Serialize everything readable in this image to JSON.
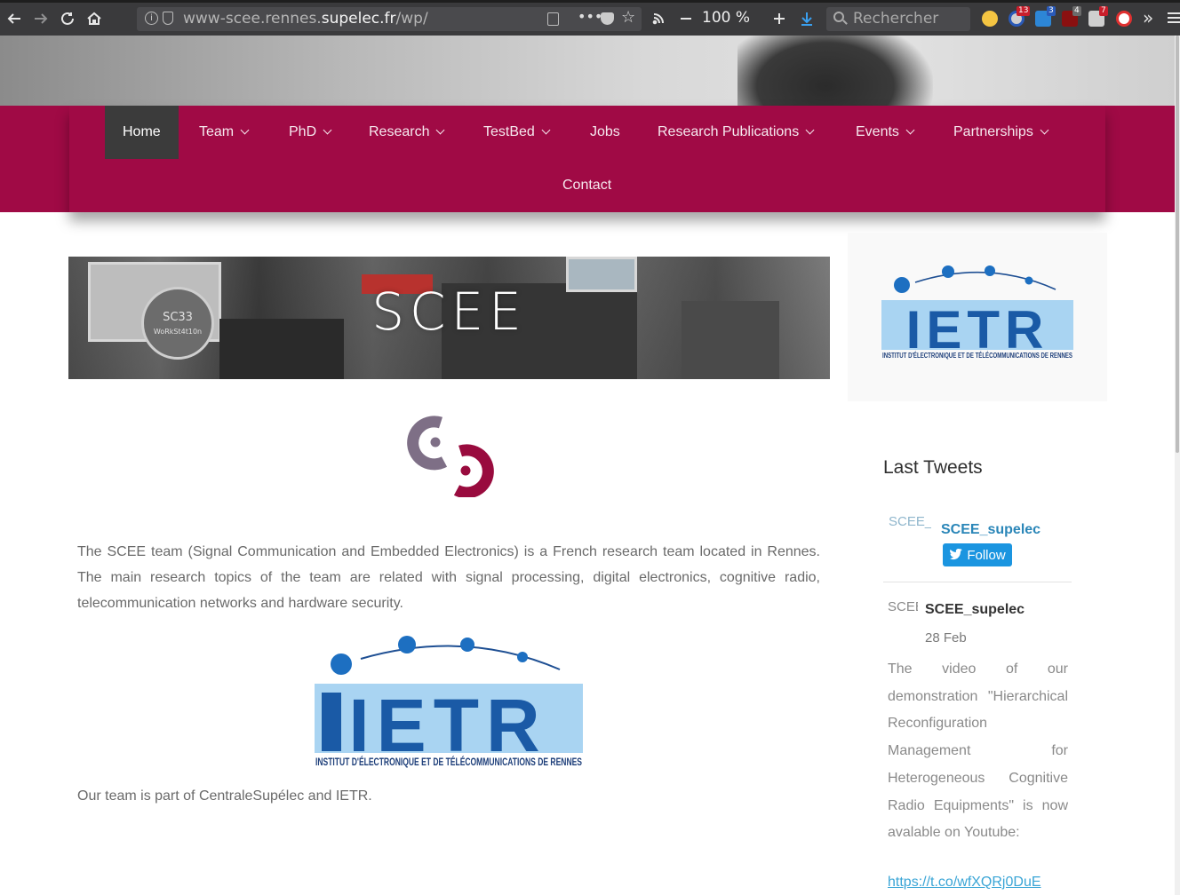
{
  "browser": {
    "url_prefix": "www-scee.rennes.",
    "url_domain": "supelec.fr",
    "url_path": "/wp/",
    "zoom": "100 %",
    "search_placeholder": "Rechercher",
    "badges": [
      "13",
      "3",
      "4",
      "7"
    ]
  },
  "nav": {
    "items": [
      {
        "label": "Home",
        "has_dropdown": false,
        "active": true
      },
      {
        "label": "Team",
        "has_dropdown": true
      },
      {
        "label": "PhD",
        "has_dropdown": true
      },
      {
        "label": "Research",
        "has_dropdown": true
      },
      {
        "label": "TestBed",
        "has_dropdown": true
      },
      {
        "label": "Jobs",
        "has_dropdown": false
      },
      {
        "label": "Research Publications",
        "has_dropdown": true
      },
      {
        "label": "Events",
        "has_dropdown": true
      },
      {
        "label": "Partnerships",
        "has_dropdown": true
      },
      {
        "label": "Contact",
        "has_dropdown": false
      }
    ]
  },
  "banner": {
    "title": "SCEE",
    "sticker_text": "SC33",
    "sticker_sub": "WoRkSt4t10n"
  },
  "content": {
    "intro": "The SCEE team (Signal Communication and Embedded Electronics) is a French research team located in Rennes. The main research topics of the team are related with signal processing, digital electronics, cognitive radio, telecommunication networks and hardware security.",
    "ietr_logo_text": "IETR",
    "ietr_logo_subtitle": "INSTITUT D'ÉLECTRONIQUE ET DE TÉLÉCOMMUNICATIONS DE RENNES",
    "part_of": "Our team is part of CentraleSupélec and IETR."
  },
  "sidebar": {
    "tweets_title": "Last Tweets",
    "account_avatar_alt": "SCEE_supelec",
    "account_handle": "SCEE_supelec",
    "follow_label": "Follow",
    "tweet": {
      "avatar_alt": "SCEE",
      "handle": "SCEE_supelec",
      "date": "28 Feb",
      "text": "The video of our demonstration \"Hierarchical Reconfiguration Management for Heterogeneous Cognitive Radio Equipments\" is now avalable on Youtube:",
      "link": "https://t.co/wfXQRj0DuE"
    }
  },
  "colors": {
    "nav_bg": "#a00a45",
    "nav_active": "#3b3b3b",
    "twitter_blue": "#1b95e0",
    "ietr_dark": "#1a5aa6",
    "ietr_light": "#a9d4f2"
  }
}
